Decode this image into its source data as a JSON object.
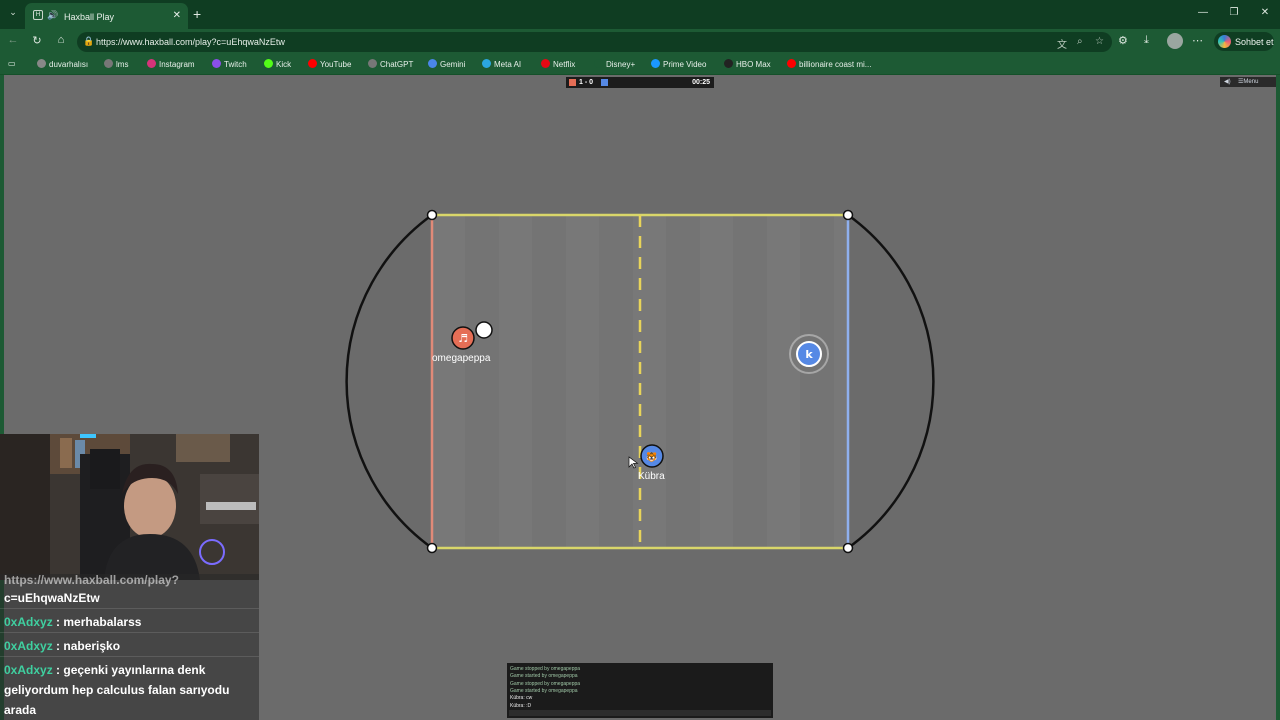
{
  "browser": {
    "tab_title": "Haxball Play",
    "url": "https://www.haxball.com/play?c=uEhqwaNzEtw",
    "copilot_label": "Sohbet et"
  },
  "bookmarks": [
    {
      "label": "duvarhalısı",
      "color": "#888"
    },
    {
      "label": "lms",
      "color": "#777"
    },
    {
      "label": "Instagram",
      "color": "#d6337a"
    },
    {
      "label": "Twitch",
      "color": "#8a4fe8"
    },
    {
      "label": "Kick",
      "color": "#53fc18"
    },
    {
      "label": "YouTube",
      "color": "#ff0000"
    },
    {
      "label": "ChatGPT",
      "color": "#777"
    },
    {
      "label": "Gemini",
      "color": "#4a86e8"
    },
    {
      "label": "Meta AI",
      "color": "#2ba7e0"
    },
    {
      "label": "Netflix",
      "color": "#e50914"
    },
    {
      "label": "Disney+",
      "color": "#1d5a34"
    },
    {
      "label": "Prime Video",
      "color": "#1a98ff"
    },
    {
      "label": "HBO Max",
      "color": "#222"
    },
    {
      "label": "billionaire coast mi...",
      "color": "#ff0000"
    }
  ],
  "scoreboard": {
    "score": "1 - 0",
    "time": "00:25"
  },
  "menu": {
    "label": "Menu"
  },
  "players": [
    {
      "name": "omegapeppa",
      "team": "red",
      "avatar": "♬"
    },
    {
      "name": "Kübra",
      "team": "blue",
      "avatar": "🐯"
    },
    {
      "name": "",
      "team": "blue",
      "avatar": "k"
    }
  ],
  "stream_chat": [
    {
      "user": "",
      "text": "https://www.haxball.com/play?"
    },
    {
      "user": "",
      "text": "c=uEhqwaNzEtw"
    },
    {
      "user": "0xAdxyz",
      "text": " : merhabalarss"
    },
    {
      "user": "0xAdxyz",
      "text": " : naberişko"
    },
    {
      "user": "0xAdxyz",
      "text": " : geçenki yayınlarına denk"
    },
    {
      "user": "",
      "text": "geliyordum hep calculus falan sarıyodu"
    },
    {
      "user": "",
      "text": "arada"
    }
  ],
  "game_chat": [
    "Game stopped by omegapeppa",
    "Game started by omegapeppa",
    "Game stopped by omegapeppa",
    "Game started by omegapeppa",
    "Kübra: cw",
    "Kübra: :D"
  ],
  "colors": {
    "red_team": "#e56e56",
    "blue_team": "#5689e5",
    "field_line": "#c7e66a",
    "ball": "#ffffff"
  }
}
